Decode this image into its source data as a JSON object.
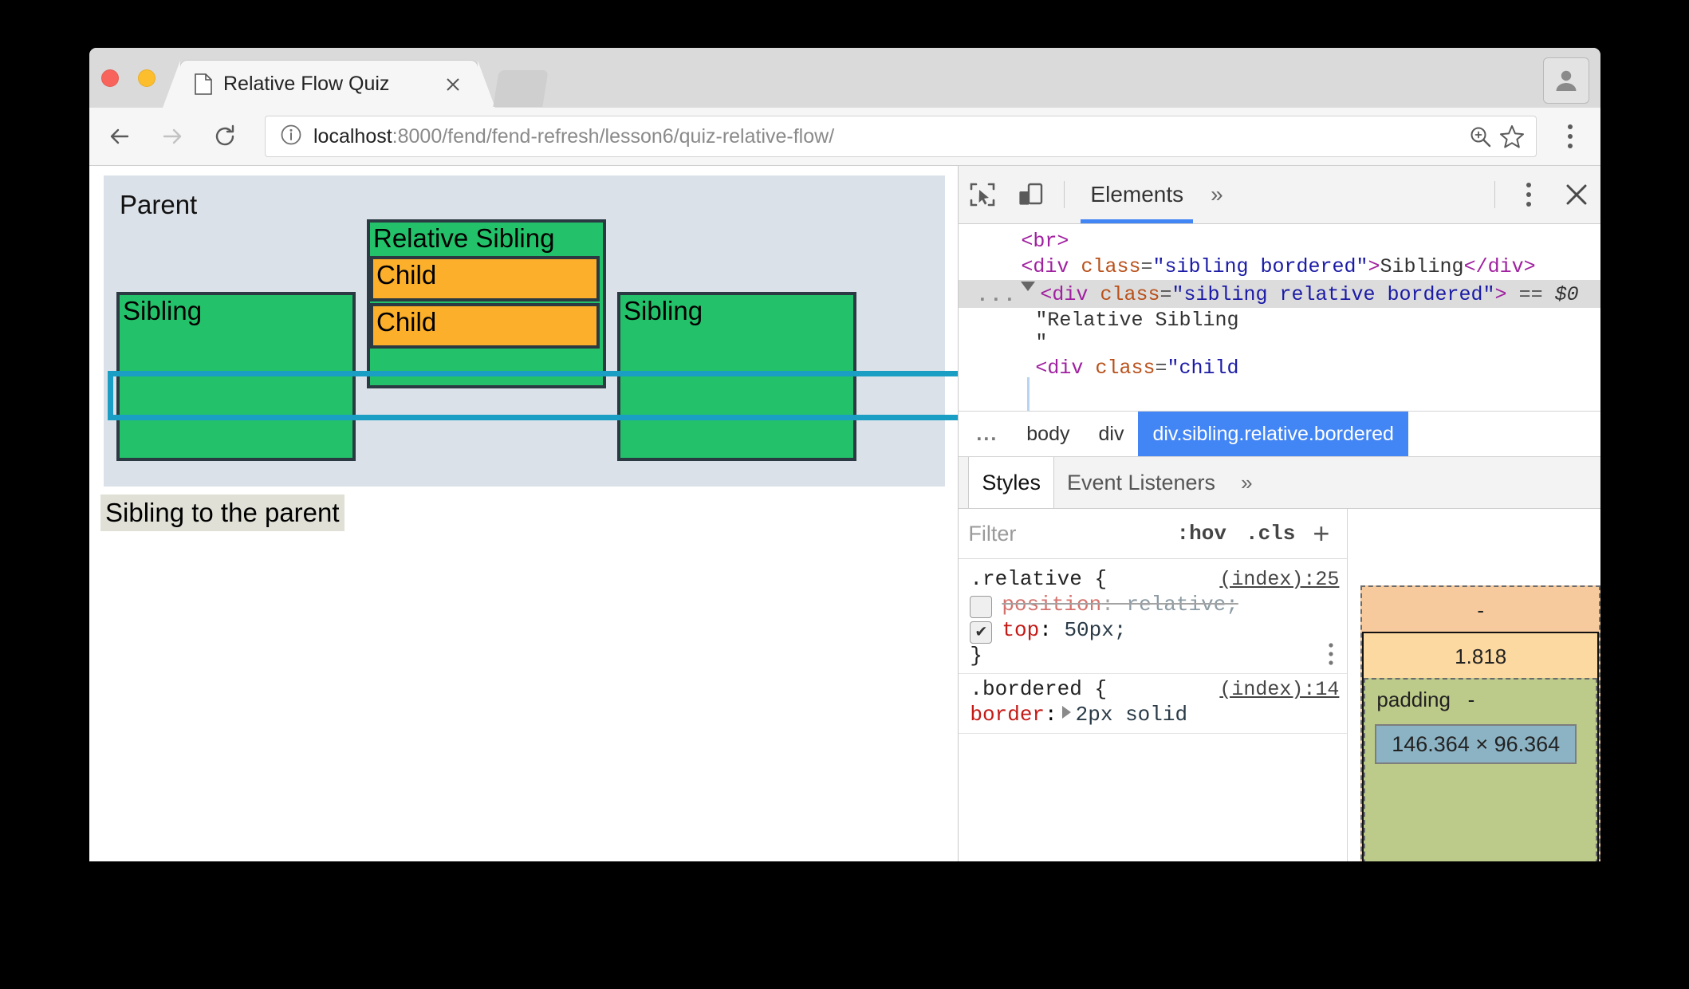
{
  "browser": {
    "traffic_lights": [
      "close-red",
      "minimize-yellow",
      "maximize-green"
    ],
    "tab": {
      "title": "Relative Flow Quiz",
      "favicon": "page-icon",
      "close": "×"
    },
    "toolbar": {
      "back": "←",
      "forward": "→",
      "reload": "↻",
      "info_icon": "info-circle-icon",
      "url_host": "localhost",
      "url_rest": ":8000/fend/fend-refresh/lesson6/quiz-relative-flow/",
      "zoom_icon": "zoom-in-icon",
      "bookmark_icon": "star-icon",
      "menu_icon": "kebab-menu-icon",
      "profile_icon": "account-icon"
    }
  },
  "page": {
    "parent_label": "Parent",
    "sibling_left": "Sibling",
    "relative_sibling": "Relative Sibling",
    "child_in_relative": "Child",
    "child_second": "Child",
    "sibling_right": "Sibling",
    "sibling_to_parent": "Sibling to the parent",
    "colors": {
      "parent_bg": "#dbe1e8",
      "sibling_green": "#23c26a",
      "child_orange": "#fbaf2a",
      "block_border": "#2b3a42",
      "inspect_highlight": "#1a9ec4",
      "sibling_parent_bg": "#e0e0d6"
    }
  },
  "devtools": {
    "toolbar": {
      "inspect_icon": "inspect-element-icon",
      "device_icon": "device-toolbar-icon",
      "tabs": [
        {
          "label": "Elements",
          "active": true
        }
      ],
      "more_tabs": "»",
      "kebab": "kebab-menu-icon",
      "close": "×"
    },
    "dom": {
      "rows": [
        {
          "indent": 1,
          "parts": [
            {
              "t": "tag",
              "v": "<br>"
            }
          ]
        },
        {
          "indent": 1,
          "parts": [
            {
              "t": "tag",
              "v": "<div "
            },
            {
              "t": "attr",
              "v": "class"
            },
            {
              "t": "eq",
              "v": "="
            },
            {
              "t": "val",
              "v": "\"sibling bordered\""
            },
            {
              "t": "tag",
              "v": ">"
            },
            {
              "t": "txt",
              "v": "Sibling"
            },
            {
              "t": "tag",
              "v": "</div>"
            }
          ]
        },
        {
          "indent": 1,
          "selected": true,
          "ellipsis": "...",
          "triangle": "open",
          "parts": [
            {
              "t": "tag",
              "v": "<div "
            },
            {
              "t": "attr",
              "v": "class"
            },
            {
              "t": "eq",
              "v": "="
            },
            {
              "t": "val",
              "v": "\"sibling relative bordered\""
            },
            {
              "t": "tag",
              "v": ">"
            },
            {
              "t": "eq",
              "v": " == "
            },
            {
              "t": "dollar",
              "v": "$0"
            }
          ]
        },
        {
          "indent": 2,
          "parts": [
            {
              "t": "txt",
              "v": "\"Relative Sibling\n\""
            }
          ]
        },
        {
          "indent": 2,
          "parts": [
            {
              "t": "tag",
              "v": "<div "
            },
            {
              "t": "attr",
              "v": "class"
            },
            {
              "t": "eq",
              "v": "="
            },
            {
              "t": "val",
              "v": "\"child"
            }
          ]
        }
      ]
    },
    "breadcrumb": [
      {
        "label": "...",
        "dots": true
      },
      {
        "label": "body"
      },
      {
        "label": "div"
      },
      {
        "label": "div.sibling.relative.bordered",
        "active": true
      }
    ],
    "styles_tabs": [
      {
        "label": "Styles",
        "active": true
      },
      {
        "label": "Event Listeners",
        "active": false
      }
    ],
    "styles_more": "»",
    "filter": {
      "placeholder": "Filter",
      "hov": ":hov",
      "cls": ".cls",
      "plus": "+"
    },
    "rules": [
      {
        "selector": ".relative {",
        "source": "(index):25",
        "declarations": [
          {
            "checked": false,
            "property": "position",
            "value": "relative;",
            "disabled": true
          },
          {
            "checked": true,
            "property": "top",
            "value": "50px;",
            "disabled": false
          }
        ],
        "close": "}",
        "kebab": "⋮"
      },
      {
        "selector": ".bordered {",
        "source": "(index):14",
        "declarations": [
          {
            "checked": true,
            "property": "border",
            "value": "2px solid",
            "disabled": false,
            "expandable": true
          }
        ],
        "close": "",
        "kebab": ""
      }
    ],
    "box_model": {
      "margin_label": "-",
      "border_value": "1.818",
      "padding_label": "padding",
      "padding_value": "-",
      "content_size": "146.364 × 96.364",
      "bottom_value": "-",
      "colors": {
        "margin": "#f6ca9c",
        "border": "#fcd9a0",
        "padding": "#bdcb8a",
        "content": "#8cb3c4"
      }
    }
  }
}
